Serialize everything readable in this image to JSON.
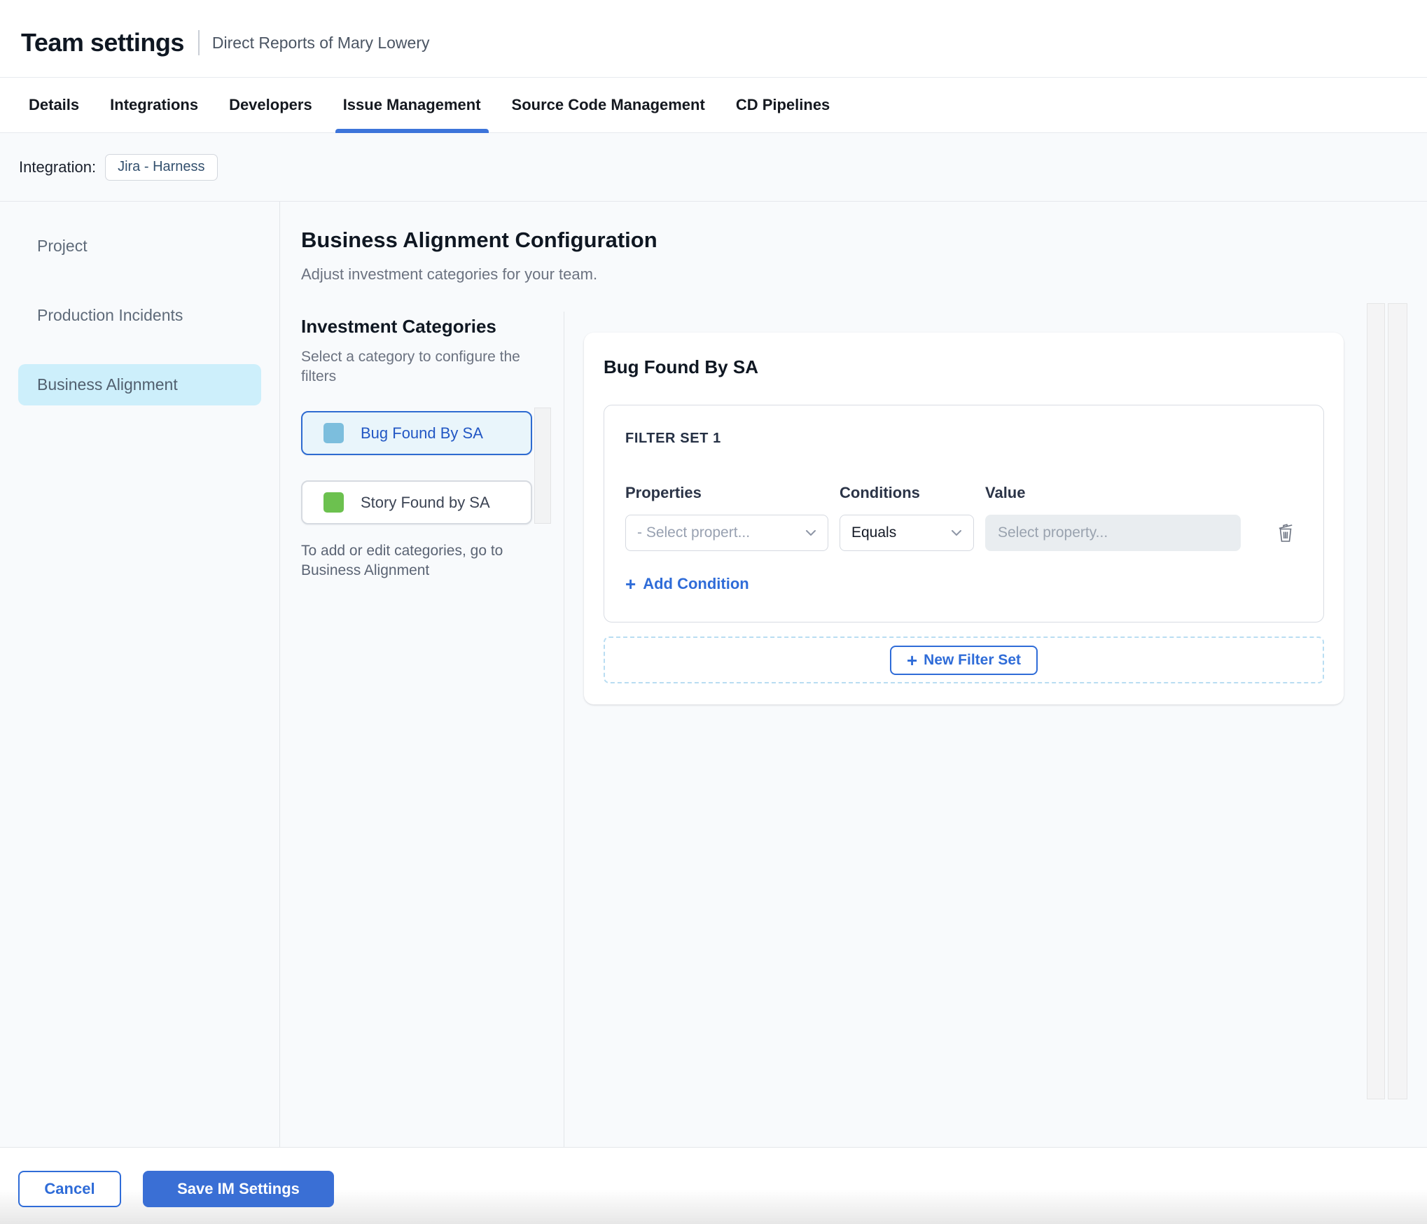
{
  "header": {
    "title": "Team settings",
    "subtitle": "Direct Reports of Mary Lowery"
  },
  "tabs": [
    {
      "label": "Details",
      "active": false
    },
    {
      "label": "Integrations",
      "active": false
    },
    {
      "label": "Developers",
      "active": false
    },
    {
      "label": "Issue Management",
      "active": true
    },
    {
      "label": "Source Code Management",
      "active": false
    },
    {
      "label": "CD Pipelines",
      "active": false
    }
  ],
  "integration": {
    "label": "Integration:",
    "value": "Jira - Harness"
  },
  "sidebar": {
    "items": [
      {
        "label": "Project",
        "active": false
      },
      {
        "label": "Production Incidents",
        "active": false
      },
      {
        "label": "Business Alignment",
        "active": true
      }
    ]
  },
  "main": {
    "title": "Business Alignment Configuration",
    "subtitle": "Adjust investment categories for your team."
  },
  "categories": {
    "title": "Investment Categories",
    "hint": "Select a category to configure the filters",
    "items": [
      {
        "label": "Bug Found By SA",
        "swatch": "#7cbedd",
        "selected": true
      },
      {
        "label": "Story Found by SA",
        "swatch": "#6cc14f",
        "selected": false
      }
    ],
    "footnote": "To add or edit categories, go to Business Alignment"
  },
  "filter_panel": {
    "title": "Bug Found By SA",
    "filter_set": {
      "title": "FILTER SET 1",
      "columns": [
        "Properties",
        "Conditions",
        "Value"
      ],
      "property_placeholder": "- Select propert...",
      "condition_value": "Equals",
      "value_placeholder": "Select property...",
      "add_condition_label": "Add Condition"
    },
    "new_filter_set_label": "New Filter Set"
  },
  "footer": {
    "cancel_label": "Cancel",
    "save_label": "Save IM Settings"
  },
  "colors": {
    "primary": "#2f6cd8",
    "tab_underline": "#3d74da",
    "sidebar_active_bg": "#cdeffb",
    "selected_category_bg": "#e9f5fb",
    "save_button_bg": "#3a6fd5",
    "swatch_blue": "#7cbedd",
    "swatch_green": "#6cc14f",
    "content_bg": "#f8fafc"
  }
}
